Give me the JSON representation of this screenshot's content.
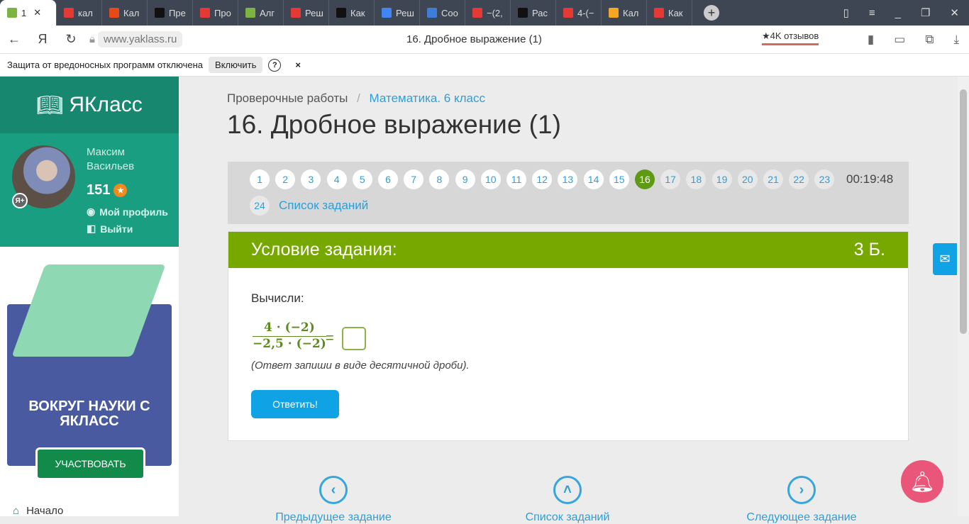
{
  "browser": {
    "tabs": [
      {
        "label": "1",
        "color": "#7cb342",
        "active": true
      },
      {
        "label": "кал",
        "color": "#e53935"
      },
      {
        "label": "Кал",
        "color": "#e64a19"
      },
      {
        "label": "Пре",
        "color": "#111"
      },
      {
        "label": "Про",
        "color": "#e53935"
      },
      {
        "label": "Алг",
        "color": "#7cb342"
      },
      {
        "label": "Реш",
        "color": "#e53935"
      },
      {
        "label": "Как",
        "color": "#111"
      },
      {
        "label": "Реш",
        "color": "#4285f4"
      },
      {
        "label": "Соо",
        "color": "#3f7ed6"
      },
      {
        "label": "−(2,",
        "color": "#e53935"
      },
      {
        "label": "Рас",
        "color": "#111"
      },
      {
        "label": "4-(−",
        "color": "#e53935"
      },
      {
        "label": "Кал",
        "color": "#f5a623"
      },
      {
        "label": "Как",
        "color": "#e53935"
      }
    ],
    "new_tab": "+",
    "url": "www.yaklass.ru",
    "page_title": "16. Дробное выражение (1)",
    "reviews": "★4K отзывов",
    "infobar": {
      "text": "Защита от вредоносных программ отключена",
      "enable": "Включить",
      "help": "?",
      "close": "×"
    }
  },
  "sidebar": {
    "logo": "ЯКласс",
    "user": {
      "first": "Максим",
      "last": "Васильев",
      "score": "151",
      "profile": "Мой профиль",
      "logout": "Выйти",
      "badge": "Я+"
    },
    "ad": {
      "title": "ВОКРУГ НАУКИ С ЯКЛАСС",
      "button": "УЧАСТВОВАТЬ"
    },
    "home": "Начало"
  },
  "main": {
    "breadcrumb": [
      "Проверочные работы",
      "Математика. 6 класс"
    ],
    "title": "16. Дробное выражение (1)",
    "pages": [
      "1",
      "2",
      "3",
      "4",
      "5",
      "6",
      "7",
      "8",
      "9",
      "10",
      "11",
      "12",
      "13",
      "14",
      "15",
      "16",
      "17",
      "18",
      "19",
      "20",
      "21",
      "22",
      "23",
      "24"
    ],
    "current_page": "16",
    "timer": "00:19:48",
    "task_list": "Список заданий",
    "task": {
      "header": "Условие задания:",
      "points": "3 Б.",
      "prompt": "Вычисли:",
      "numerator": "4 · (−2)",
      "denominator": "−2,5 · (−2)",
      "equals": "=",
      "hint": "(Ответ запиши в виде десятичной дроби).",
      "submit": "Ответить!"
    },
    "nav": {
      "prev": "Предыдущее задание",
      "list": "Список заданий",
      "next": "Следующее задание"
    }
  }
}
